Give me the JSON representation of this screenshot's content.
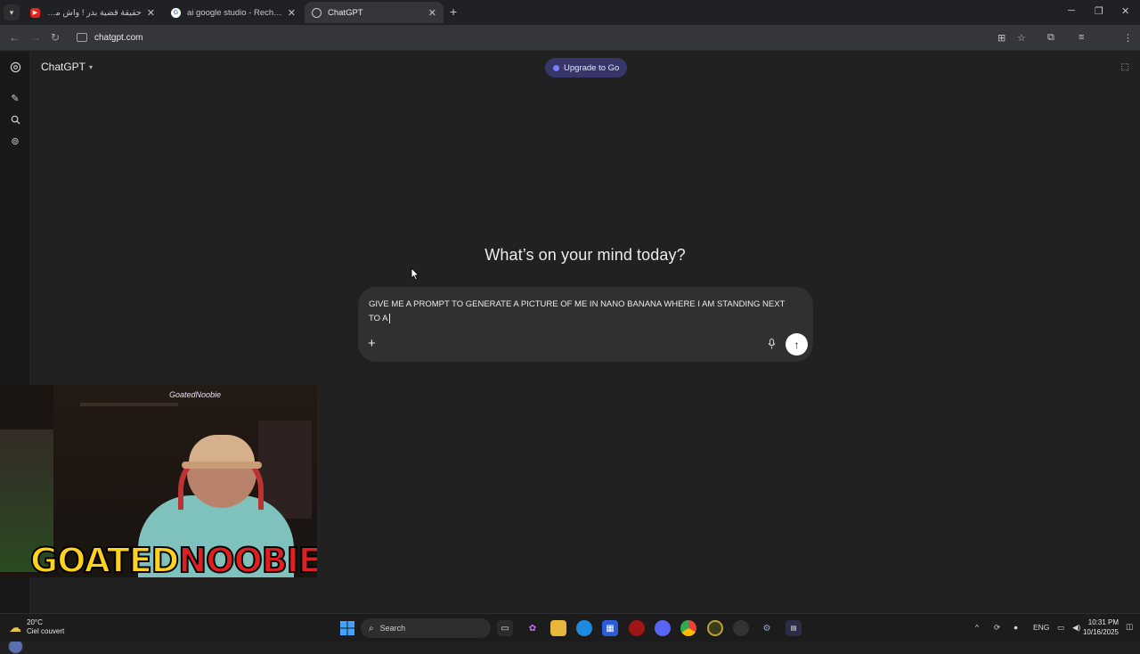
{
  "browser": {
    "tabs": [
      {
        "title": "حقيقة قضية بدر ! واش مرتو دات",
        "favicon": "youtube-icon",
        "active": false
      },
      {
        "title": "ai google studio - Recherche G",
        "favicon": "google-icon",
        "active": false
      },
      {
        "title": "ChatGPT",
        "favicon": "chatgpt-icon",
        "active": true
      }
    ],
    "url": "chatgpt.com"
  },
  "app": {
    "model_label": "ChatGPT",
    "upgrade_label": "Upgrade to Go",
    "headline": "What’s on your mind today?",
    "prompt_text": "GIVE ME A PROMPT TO GENERATE A PICTURE OF ME IN NANO BANANA WHERE I AM STANDING NEXT TO A",
    "accent_color": "#373669"
  },
  "overlay": {
    "streamer_name_part1": "GOATED",
    "streamer_name_part2": "NOOBIE",
    "cam_tag": "GoatedNoobie"
  },
  "taskbar": {
    "weather_temp": "20°C",
    "weather_desc": "Ciel couvert",
    "search_placeholder": "Search",
    "language": "ENG",
    "time": "10:31 PM",
    "date": "10/16/2025"
  }
}
